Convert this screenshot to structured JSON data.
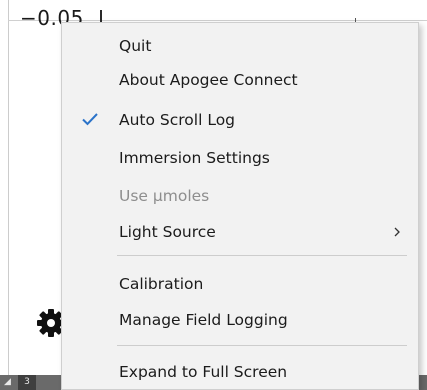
{
  "background": {
    "axis_label": "−0.05",
    "status_cell": "3"
  },
  "menu": {
    "items": [
      {
        "label": "Quit",
        "checked": false,
        "disabled": false,
        "submenu": false
      },
      {
        "label": "About Apogee Connect",
        "checked": false,
        "disabled": false,
        "submenu": false
      },
      {
        "label": "Auto Scroll Log",
        "checked": true,
        "disabled": false,
        "submenu": false
      },
      {
        "label": "Immersion Settings",
        "checked": false,
        "disabled": false,
        "submenu": false
      },
      {
        "label": "Use µmoles",
        "checked": false,
        "disabled": true,
        "submenu": false
      },
      {
        "label": "Light Source",
        "checked": false,
        "disabled": false,
        "submenu": true
      },
      {
        "label": "Calibration",
        "checked": false,
        "disabled": false,
        "submenu": false
      },
      {
        "label": "Manage Field Logging",
        "checked": false,
        "disabled": false,
        "submenu": false
      },
      {
        "label": "Expand to Full Screen",
        "checked": false,
        "disabled": false,
        "submenu": false
      }
    ]
  },
  "colors": {
    "menu_background": "#f2f2f2",
    "check_accent": "#2b73c9",
    "disabled_text": "#8e8e8e"
  },
  "icons": {
    "check": "checkmark-icon",
    "submenu": "chevron-right-icon",
    "gear": "gear-icon"
  }
}
